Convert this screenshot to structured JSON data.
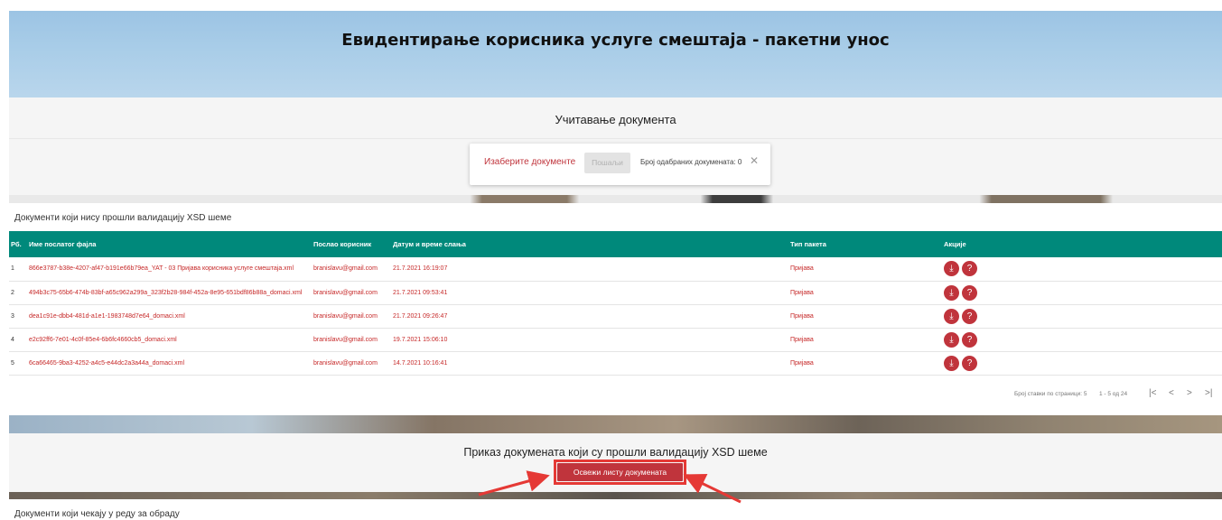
{
  "banner": {
    "title": "Евидентирање корисника услуге смештаја - пакетни унос"
  },
  "upload": {
    "title": "Учитавање документа",
    "choose_label": "Изаберите документе",
    "send_label": "Пошаљи",
    "count_label": "Број одабраних докумената: 0",
    "close_icon": "close-icon"
  },
  "invalid": {
    "heading": "Документи који нису прошли валидацију XSD шеме",
    "columns": [
      "Рб.",
      "Име послатог фајла",
      "Послао корисник",
      "Датум и време слања",
      "Тип пакета",
      "Акције"
    ],
    "rows": [
      {
        "num": "1",
        "file": "866e3787-b38e-4207-af47-b191e66b79ea_YAT - 03 Пријава корисника услуге смештаја.xml",
        "user": "branislavu@gmail.com",
        "date": "21.7.2021 16:19:07",
        "type": "Пријава"
      },
      {
        "num": "2",
        "file": "494b3c75-65b6-474b-83bf-a65c962a299a_323f2b28-984f-452a-8e95-651bdf86b88a_domaci.xml",
        "user": "branislavu@gmail.com",
        "date": "21.7.2021 09:53:41",
        "type": "Пријава"
      },
      {
        "num": "3",
        "file": "dea1c91e-dbb4-481d-a1e1-1983748d7e64_domaci.xml",
        "user": "branislavu@gmail.com",
        "date": "21.7.2021 09:26:47",
        "type": "Пријава"
      },
      {
        "num": "4",
        "file": "e2c92ff6-7e01-4c0f-85e4-6b6fc4660cb5_domaci.xml",
        "user": "branislavu@gmail.com",
        "date": "19.7.2021 15:06:10",
        "type": "Пријава"
      },
      {
        "num": "5",
        "file": "6ca66465-9ba3-4252-a4c5-e44dc2a3a44a_domaci.xml",
        "user": "branislavu@gmail.com",
        "date": "14.7.2021 10:16:41",
        "type": "Пријава"
      }
    ],
    "action_icons": [
      "download-icon",
      "help-icon"
    ],
    "pager": {
      "items_label": "Број ставки по страници: 5",
      "range": "1 - 5 од 24"
    }
  },
  "valid": {
    "title": "Приказ докумената који су прошли валидацију XSD шеме",
    "refresh_label": "Освежи листу докумената"
  },
  "queue": {
    "heading": "Документи који чекају у реду за обраду"
  },
  "colors": {
    "teal_header": "#00897b",
    "accent_red": "#c0343c",
    "highlight_red": "#e53935"
  }
}
